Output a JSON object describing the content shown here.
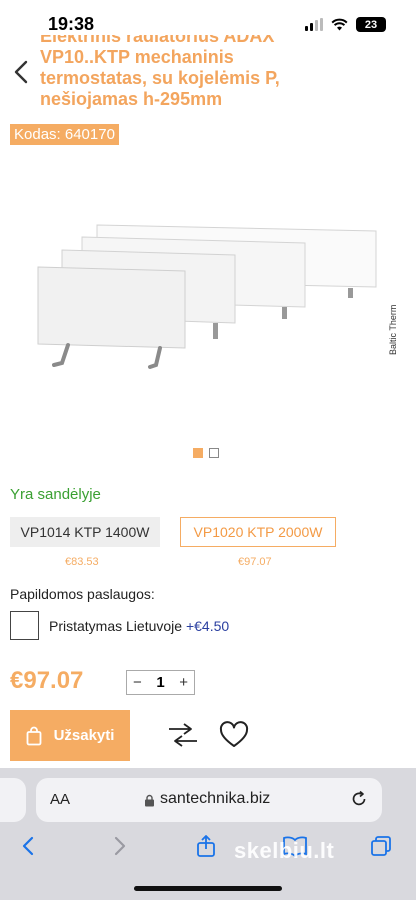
{
  "status_bar": {
    "time": "19:38",
    "battery": "23"
  },
  "product": {
    "title_lines": [
      "Elektrinis radiatorius ADAX",
      "VP10..KTP mechaninis",
      "termostatas, su kojelėmis P,",
      "nešiojamas h-295mm"
    ],
    "code": "Kodas: 640170",
    "image_caption": "Baltic Therm",
    "gallery": {
      "current": 1,
      "total": 2
    },
    "stock": "Yra sandėlyje",
    "variants": [
      {
        "label": "VP1014 KTP 1400W",
        "price": "€83.53",
        "selected": false
      },
      {
        "label": "VP1020 KTP 2000W",
        "price": "€97.07",
        "selected": true
      }
    ],
    "services_title": "Papildomos paslaugos:",
    "service": {
      "label": "Pristatymas Lietuvoje",
      "price": "+€4.50"
    },
    "price": "€97.07",
    "quantity": "1",
    "qty_minus": "−",
    "qty_plus": "+",
    "order_label": "Užsakyti"
  },
  "browser": {
    "aa": "AA",
    "url": "santechnika.biz",
    "watermark": "skelbiu.lt"
  },
  "colors": {
    "accent": "#f5ac63",
    "stock": "#3aa032",
    "service_price": "#2a3fa0"
  },
  "icons": [
    "back-chevron-icon",
    "bag-icon",
    "compare-icon",
    "heart-icon",
    "lock-icon",
    "reload-icon",
    "share-icon",
    "bookmarks-icon",
    "tabs-icon"
  ]
}
